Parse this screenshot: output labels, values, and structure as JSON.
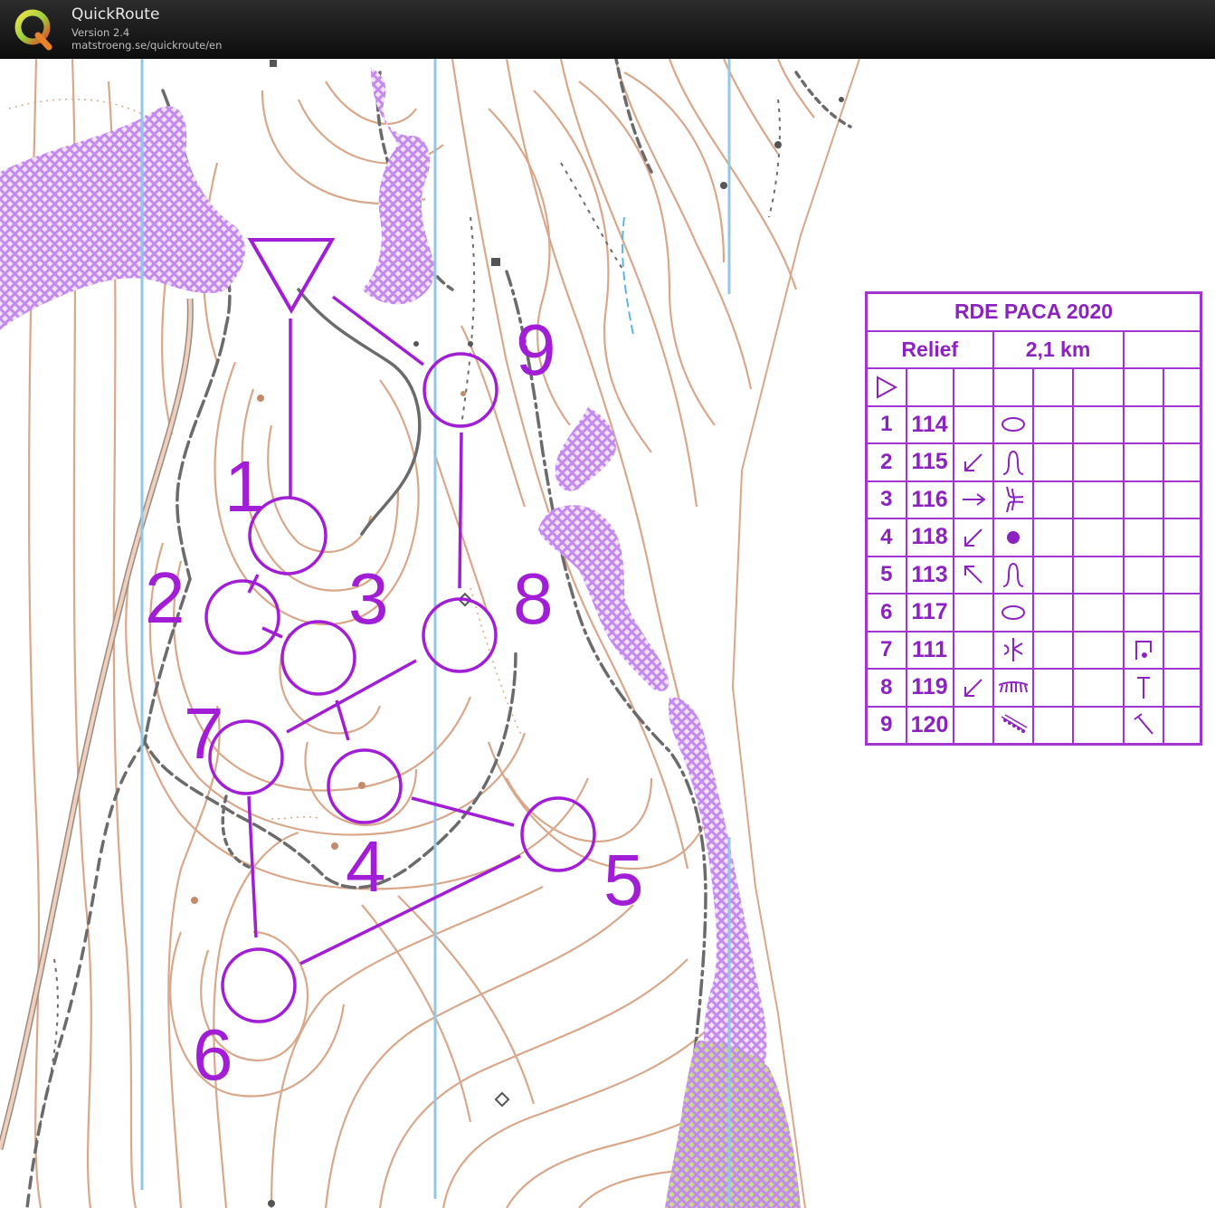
{
  "window": {
    "app_name": "QuickRoute",
    "version": "Version 2.4",
    "url": "matstroeng.se/quickroute/en",
    "logo_letter": "Q"
  },
  "colors": {
    "course": "#a21ed6",
    "table": "#a235d0",
    "contour": "#d9a78a",
    "north_lines": "#92c7e6",
    "forbidden": "#c58af0",
    "path": "#6b6b6b"
  },
  "map": {
    "start_symbol": "start-triangle",
    "controls": [
      {
        "label": "1"
      },
      {
        "label": "2"
      },
      {
        "label": "3"
      },
      {
        "label": "4"
      },
      {
        "label": "5"
      },
      {
        "label": "6"
      },
      {
        "label": "7"
      },
      {
        "label": "8"
      },
      {
        "label": "9"
      }
    ]
  },
  "description_sheet": {
    "event": "RDE PACA 2020",
    "course": "Relief",
    "length": "2,1 km",
    "start_symbol": "start-triangle-icon",
    "rows": [
      {
        "num": "1",
        "code": "114",
        "dir": "",
        "feature": "knoll-oval-icon",
        "extra": ""
      },
      {
        "num": "2",
        "code": "115",
        "dir": "arrow-down-left-icon",
        "feature": "spur-icon",
        "extra": ""
      },
      {
        "num": "3",
        "code": "116",
        "dir": "arrow-right-icon",
        "feature": "re-entrant-spur-icon",
        "extra": ""
      },
      {
        "num": "4",
        "code": "118",
        "dir": "arrow-down-left-icon",
        "feature": "dot-knoll-icon",
        "extra": ""
      },
      {
        "num": "5",
        "code": "113",
        "dir": "arrow-up-left-icon",
        "feature": "spur-icon",
        "extra": ""
      },
      {
        "num": "6",
        "code": "117",
        "dir": "",
        "feature": "knoll-oval-icon",
        "extra": ""
      },
      {
        "num": "7",
        "code": "111",
        "dir": "",
        "feature": "saddle-icon",
        "extra": "foot-corner-icon"
      },
      {
        "num": "8",
        "code": "119",
        "dir": "arrow-down-left-icon",
        "feature": "earth-bank-icon",
        "extra": "top-icon"
      },
      {
        "num": "9",
        "code": "120",
        "dir": "",
        "feature": "rocky-ground-icon",
        "extra": "foot-diagonal-icon"
      }
    ]
  }
}
